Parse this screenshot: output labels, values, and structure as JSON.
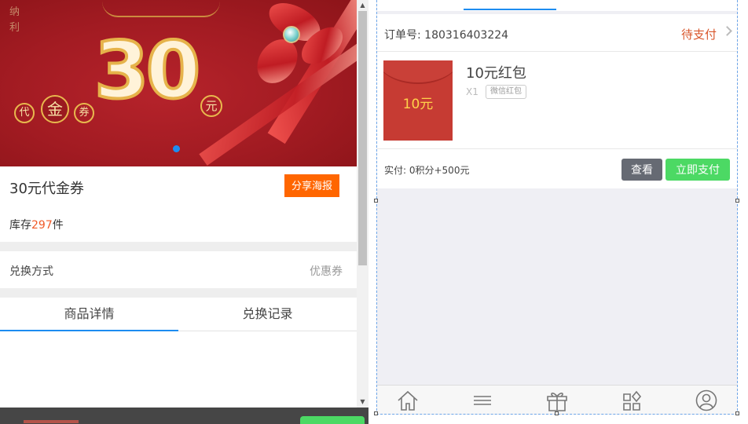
{
  "left": {
    "banner": {
      "number": "30",
      "unit": "元",
      "coupon_chars": [
        "代",
        "金",
        "券"
      ],
      "logo_text": "纳利"
    },
    "product": {
      "title": "30元代金券",
      "share_label": "分享海报",
      "stock_prefix": "库存",
      "stock_count": "297",
      "stock_suffix": "件"
    },
    "exchange": {
      "label": "兑换方式",
      "value": "优惠券"
    },
    "tabs": [
      {
        "label": "商品详情",
        "active": true
      },
      {
        "label": "兑换记录",
        "active": false
      }
    ]
  },
  "order": {
    "number_label": "订单号: 180316403224",
    "status": "待支付",
    "item": {
      "thumb_text": "10元",
      "name": "10元红包",
      "quantity": "X1",
      "tag": "微信红包"
    },
    "paid": "实付: 0积分+500元",
    "view_label": "查看",
    "pay_label": "立即支付"
  },
  "bottom_nav": [
    {
      "icon": "home-icon"
    },
    {
      "icon": "menu-icon"
    },
    {
      "icon": "gift-icon"
    },
    {
      "icon": "category-icon"
    },
    {
      "icon": "user-icon"
    }
  ],
  "colors": {
    "accent_blue": "#1d8cf0",
    "share_orange": "#ff6600",
    "status_red": "#d9572c",
    "pay_green": "#4cd964",
    "view_gray": "#666a73"
  }
}
